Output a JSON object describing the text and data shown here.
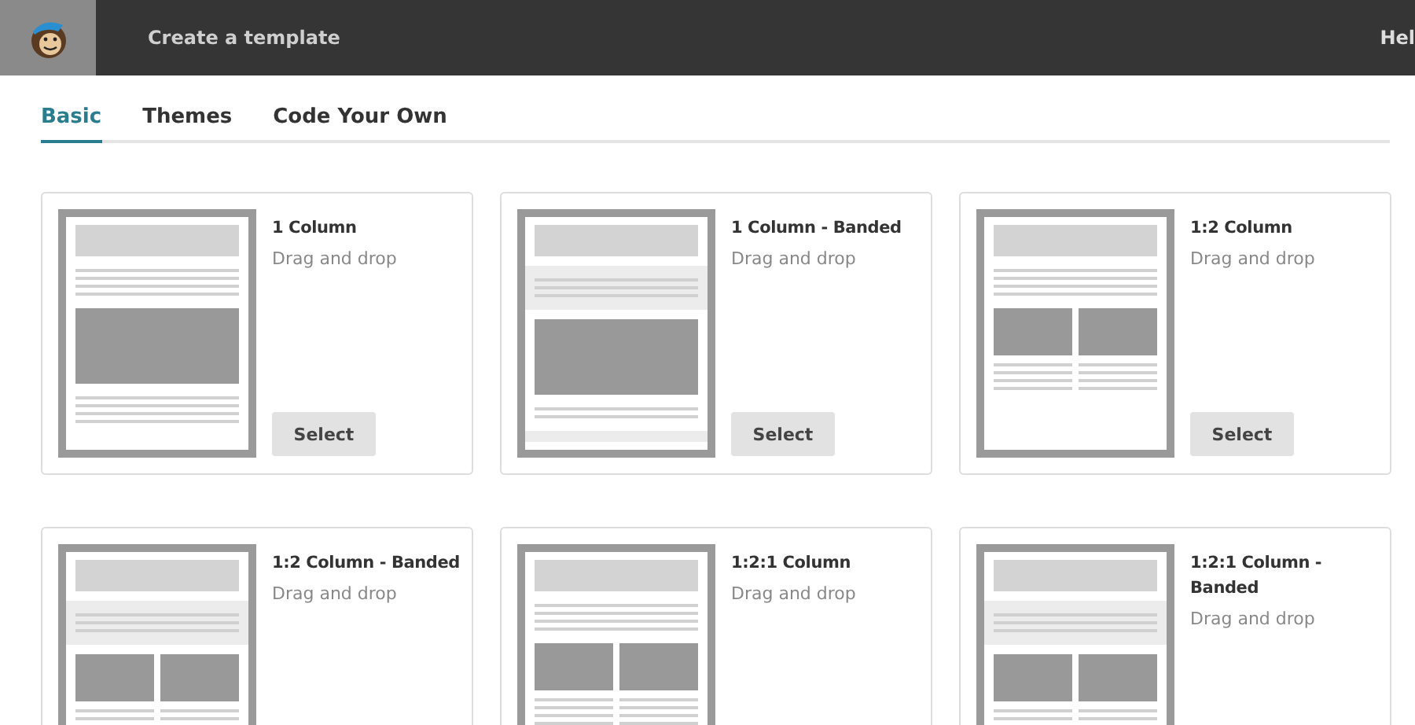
{
  "header": {
    "title": "Create a template",
    "help": "Hel"
  },
  "tabs": [
    {
      "label": "Basic",
      "selected": true
    },
    {
      "label": "Themes",
      "selected": false
    },
    {
      "label": "Code Your Own",
      "selected": false
    }
  ],
  "templates": [
    {
      "name": "1 Column",
      "description": "Drag and drop",
      "kind": "single",
      "banded": false,
      "button": "Select"
    },
    {
      "name": "1 Column - Banded",
      "description": "Drag and drop",
      "kind": "single",
      "banded": true,
      "button": "Select"
    },
    {
      "name": "1:2 Column",
      "description": "Drag and drop",
      "kind": "split",
      "banded": false,
      "button": "Select"
    },
    {
      "name": "1:2 Column - Banded",
      "description": "Drag and drop",
      "kind": "split",
      "banded": true
    },
    {
      "name": "1:2:1 Column",
      "description": "Drag and drop",
      "kind": "split-footer",
      "banded": false
    },
    {
      "name": "1:2:1 Column - Banded",
      "description": "Drag and drop",
      "kind": "split-footer",
      "banded": true
    }
  ]
}
